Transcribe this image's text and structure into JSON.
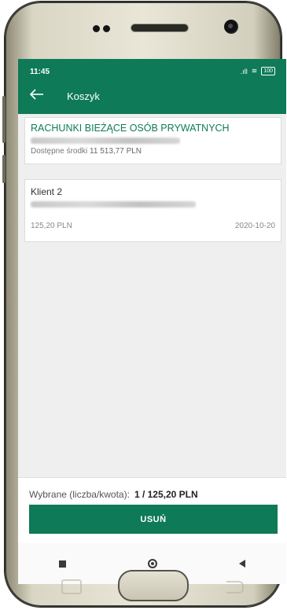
{
  "status_bar": {
    "time": "11:45",
    "battery": "100"
  },
  "header": {
    "title": "Koszyk"
  },
  "account": {
    "name": "RACHUNKI BIEŻĄCE OSÓB PRYWATNYCH",
    "available_label": "Dostępne środki",
    "available_value": "11 513,77 PLN"
  },
  "transfer": {
    "recipient": "Klient 2",
    "amount": "125,20 PLN",
    "date": "2020-10-20"
  },
  "summary": {
    "label": "Wybrane (liczba/kwota):",
    "value": "1 / 125,20 PLN"
  },
  "actions": {
    "remove_label": "USUŃ"
  },
  "colors": {
    "brand_green": "#0e7a57"
  },
  "icons": {
    "back": "arrow-left-icon",
    "nav_recent": "square-icon",
    "nav_home": "circle-icon",
    "nav_back": "triangle-back-icon"
  }
}
